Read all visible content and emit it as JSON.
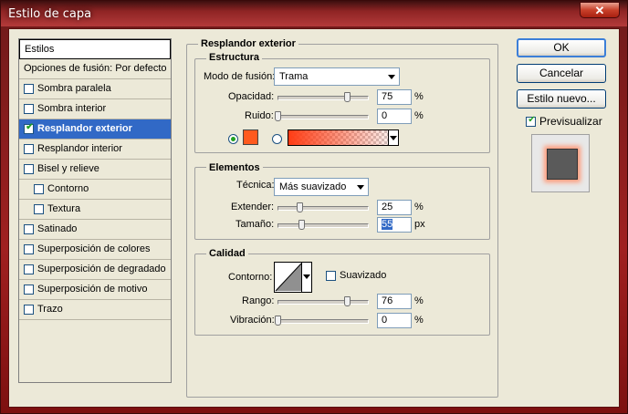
{
  "window": {
    "title": "Estilo de capa",
    "close_glyph": "✕"
  },
  "styles_panel": {
    "header": "Estilos",
    "blend_options": "Opciones de fusión: Por defecto",
    "items": [
      {
        "label": "Sombra paralela",
        "checked": false
      },
      {
        "label": "Sombra interior",
        "checked": false
      },
      {
        "label": "Resplandor exterior",
        "checked": true
      },
      {
        "label": "Resplandor interior",
        "checked": false
      },
      {
        "label": "Bisel y relieve",
        "checked": false
      },
      {
        "label": "Contorno",
        "checked": false
      },
      {
        "label": "Textura",
        "checked": false
      },
      {
        "label": "Satinado",
        "checked": false
      },
      {
        "label": "Superposición de colores",
        "checked": false
      },
      {
        "label": "Superposición de degradado",
        "checked": false
      },
      {
        "label": "Superposición de motivo",
        "checked": false
      },
      {
        "label": "Trazo",
        "checked": false
      }
    ]
  },
  "main": {
    "title": "Resplandor exterior",
    "structure": {
      "title": "Estructura",
      "blend_mode_label": "Modo de fusión:",
      "blend_mode_value": "Trama",
      "opacity_label": "Opacidad:",
      "opacity_value": "75",
      "opacity_unit": "%",
      "noise_label": "Ruido:",
      "noise_value": "0",
      "noise_unit": "%",
      "glow_color": "#ff5a1e"
    },
    "elements": {
      "title": "Elementos",
      "technique_label": "Técnica:",
      "technique_value": "Más suavizado",
      "spread_label": "Extender:",
      "spread_value": "25",
      "spread_unit": "%",
      "size_label": "Tamaño:",
      "size_value": "55",
      "size_unit": "px"
    },
    "quality": {
      "title": "Calidad",
      "contour_label": "Contorno:",
      "antialiased_label": "Suavizado",
      "range_label": "Rango:",
      "range_value": "76",
      "range_unit": "%",
      "jitter_label": "Vibración:",
      "jitter_value": "0",
      "jitter_unit": "%"
    }
  },
  "buttons": {
    "ok": "OK",
    "cancel": "Cancelar",
    "new_style": "Estilo nuevo...",
    "preview_label": "Previsualizar"
  }
}
